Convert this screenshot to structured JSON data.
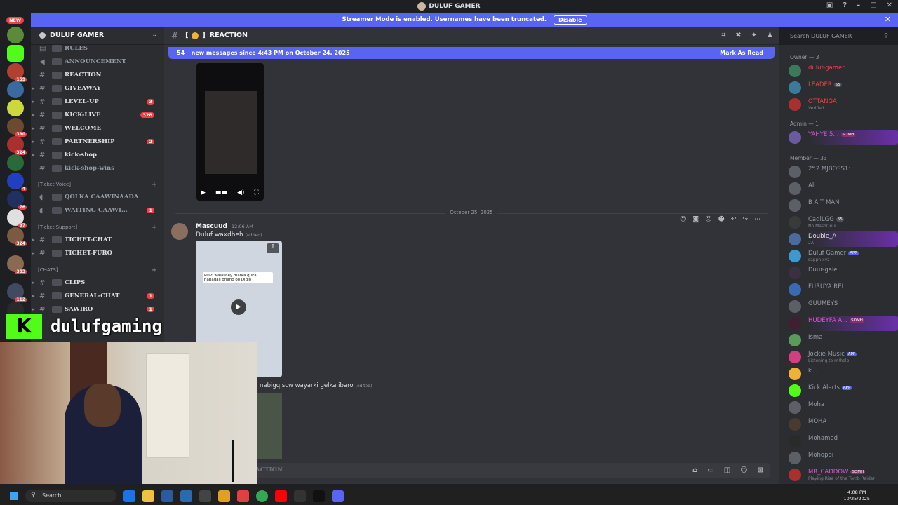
{
  "window": {
    "title": "DULUF GAMER"
  },
  "banner": {
    "text": "Streamer Mode is enabled. Usernames have been truncated.",
    "button": "Disable"
  },
  "rail": {
    "new_label": "NEW",
    "badges": [
      "159",
      "390",
      "324",
      "4",
      "76",
      "97",
      "324",
      "383",
      "112",
      "29"
    ]
  },
  "server": {
    "name": "DULUF GAMER"
  },
  "channels": [
    {
      "name": "RULES"
    },
    {
      "name": "ANNOUNCEMENT"
    },
    {
      "name": "REACTION"
    },
    {
      "name": "GIVEAWAY"
    },
    {
      "name": "LEVEL-UP",
      "count": "3"
    },
    {
      "name": "KICK-LIVE",
      "count": "328"
    },
    {
      "name": "WELCOME"
    },
    {
      "name": "PARTNERSHIP",
      "count": "2"
    },
    {
      "name": "kick-shop"
    },
    {
      "name": "kick-shop-wins"
    }
  ],
  "categories": {
    "ticket_voice": "[Ticket Voice]",
    "ticket_support": "[Ticket Support]",
    "chats": "[CHATS]"
  },
  "voice_channels": [
    {
      "name": "QOLKA CAAWINAADA"
    },
    {
      "name": "WAITING CAAWI...",
      "count": "1"
    }
  ],
  "support_channels": [
    {
      "name": "TICHET-CHAT"
    },
    {
      "name": "TICHET-FURO"
    }
  ],
  "chat_channels": [
    {
      "name": "CLIPS"
    },
    {
      "name": "GENERAL-CHAT",
      "count": "1"
    },
    {
      "name": "SAWIRO",
      "count": "1"
    }
  ],
  "chat": {
    "channel": "REACTION",
    "new_messages": "54+ new messages since 4:43 PM on October 24, 2025",
    "mark_read": "Mark As Read",
    "date_divider": "October 25, 2025",
    "author": "Mascuud",
    "time": "12:06 AM",
    "message1": "Duluf waxdheh",
    "edited": "(edited)",
    "video_caption": "POV: waiashey marka quka nabagaji dhaho oo Didio",
    "message2": "nabigq scw wayarki gelka ibaro",
    "compose_placeholder": "ACTION"
  },
  "search": {
    "placeholder": "Search DULUF GAMER"
  },
  "members": {
    "owner_header": "Owner — 3",
    "admin_header": "Admin — 1",
    "member_header": "Member — 33",
    "owners": [
      {
        "name": "duluf-gamer",
        "color": "#f23f43"
      },
      {
        "name": "LEADER",
        "tag": "55",
        "color": "#f23f43"
      },
      {
        "name": "OTTANGA",
        "sub": "Verified",
        "color": "#f23f43"
      }
    ],
    "admins": [
      {
        "name": "YAHYE 5...",
        "tag": "SOMH",
        "color": "#e84fd0"
      }
    ],
    "list": [
      {
        "name": "252 MJBOSS1:"
      },
      {
        "name": "Ali"
      },
      {
        "name": "B A T MAN"
      },
      {
        "name": "CaqiLGG",
        "tag": "55",
        "sub": "No MashQuul..."
      },
      {
        "name": "Double_A",
        "sub": "2A"
      },
      {
        "name": "Duluf Gamer",
        "tag": "APP",
        "sub": "sapph.xyz"
      },
      {
        "name": "Duur-gale"
      },
      {
        "name": "FURUYA REI"
      },
      {
        "name": "GUUMEYS"
      },
      {
        "name": "HUDEYFA A...",
        "tag": "SOMH"
      },
      {
        "name": "Isma"
      },
      {
        "name": "Jockie Music",
        "tag": "APP",
        "sub": "Listening to m!help"
      },
      {
        "name": "k..."
      },
      {
        "name": "Kick Alerts",
        "tag": "APP"
      },
      {
        "name": "Moha"
      },
      {
        "name": "MOHA"
      },
      {
        "name": "Mohamed"
      },
      {
        "name": "Mohopoi"
      },
      {
        "name": "MR_CADDOW",
        "tag": "SOMH",
        "sub": "Playing Rise of the Tomb Raider"
      }
    ]
  },
  "overlay": {
    "brand": "dulufgaming",
    "logo": "K"
  },
  "taskbar": {
    "search": "Search",
    "time": "4:08 PM",
    "date": "10/25/2025"
  },
  "colors": {
    "accent": "#5865f2",
    "badge": "#f23f43",
    "kick": "#53fc18"
  }
}
